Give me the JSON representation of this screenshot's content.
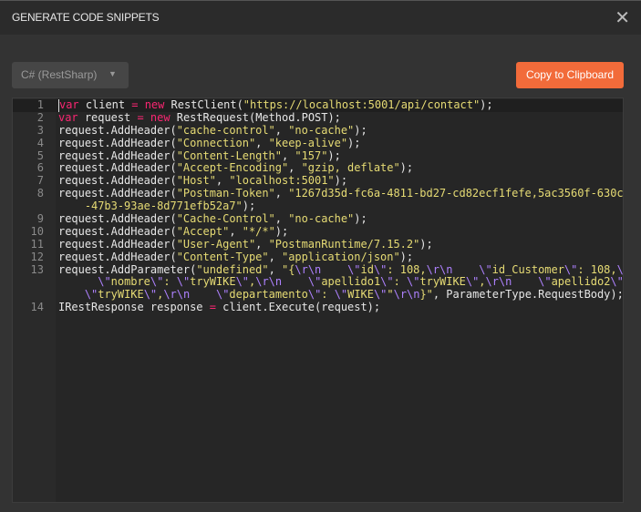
{
  "dialog": {
    "title": "GENERATE CODE SNIPPETS",
    "close_icon": "close-icon"
  },
  "toolbar": {
    "language": "C# (RestSharp)",
    "copy_label": "Copy to Clipboard",
    "accent": "#f26b3a"
  },
  "code": [
    {
      "n": "1",
      "rows": [
        [
          [
            "kw",
            "var"
          ],
          [
            "plain",
            " client "
          ],
          [
            "kw",
            "="
          ],
          [
            "plain",
            " "
          ],
          [
            "kw",
            "new"
          ],
          [
            "plain",
            " RestClient("
          ],
          [
            "str",
            "\"https://localhost:5001/api/contact\""
          ],
          [
            "plain",
            ");"
          ]
        ]
      ]
    },
    {
      "n": "2",
      "rows": [
        [
          [
            "kw",
            "var"
          ],
          [
            "plain",
            " request "
          ],
          [
            "kw",
            "="
          ],
          [
            "plain",
            " "
          ],
          [
            "kw",
            "new"
          ],
          [
            "plain",
            " RestRequest(Method.POST);"
          ]
        ]
      ]
    },
    {
      "n": "3",
      "rows": [
        [
          [
            "plain",
            "request.AddHeader("
          ],
          [
            "str",
            "\"cache-control\""
          ],
          [
            "plain",
            ", "
          ],
          [
            "str",
            "\"no-cache\""
          ],
          [
            "plain",
            ");"
          ]
        ]
      ]
    },
    {
      "n": "4",
      "rows": [
        [
          [
            "plain",
            "request.AddHeader("
          ],
          [
            "str",
            "\"Connection\""
          ],
          [
            "plain",
            ", "
          ],
          [
            "str",
            "\"keep-alive\""
          ],
          [
            "plain",
            ");"
          ]
        ]
      ]
    },
    {
      "n": "5",
      "rows": [
        [
          [
            "plain",
            "request.AddHeader("
          ],
          [
            "str",
            "\"Content-Length\""
          ],
          [
            "plain",
            ", "
          ],
          [
            "str",
            "\"157\""
          ],
          [
            "plain",
            ");"
          ]
        ]
      ]
    },
    {
      "n": "6",
      "rows": [
        [
          [
            "plain",
            "request.AddHeader("
          ],
          [
            "str",
            "\"Accept-Encoding\""
          ],
          [
            "plain",
            ", "
          ],
          [
            "str",
            "\"gzip, deflate\""
          ],
          [
            "plain",
            ");"
          ]
        ]
      ]
    },
    {
      "n": "7",
      "rows": [
        [
          [
            "plain",
            "request.AddHeader("
          ],
          [
            "str",
            "\"Host\""
          ],
          [
            "plain",
            ", "
          ],
          [
            "str",
            "\"localhost:5001\""
          ],
          [
            "plain",
            ");"
          ]
        ]
      ]
    },
    {
      "n": "8",
      "rows": [
        [
          [
            "plain",
            "request.AddHeader("
          ],
          [
            "str",
            "\"Postman-Token\""
          ],
          [
            "plain",
            ", "
          ],
          [
            "str",
            "\"1267d35d-fc6a-4811-bd27-cd82ecf1fefe,5ac3560f-630c"
          ]
        ],
        [
          [
            "str",
            "    -47b3-93ae-8d771efb52a7\""
          ],
          [
            "plain",
            ");"
          ]
        ]
      ]
    },
    {
      "n": "9",
      "rows": [
        [
          [
            "plain",
            "request.AddHeader("
          ],
          [
            "str",
            "\"Cache-Control\""
          ],
          [
            "plain",
            ", "
          ],
          [
            "str",
            "\"no-cache\""
          ],
          [
            "plain",
            ");"
          ]
        ]
      ]
    },
    {
      "n": "10",
      "rows": [
        [
          [
            "plain",
            "request.AddHeader("
          ],
          [
            "str",
            "\"Accept\""
          ],
          [
            "plain",
            ", "
          ],
          [
            "str",
            "\"*/*\""
          ],
          [
            "plain",
            ");"
          ]
        ]
      ]
    },
    {
      "n": "11",
      "rows": [
        [
          [
            "plain",
            "request.AddHeader("
          ],
          [
            "str",
            "\"User-Agent\""
          ],
          [
            "plain",
            ", "
          ],
          [
            "str",
            "\"PostmanRuntime/7.15.2\""
          ],
          [
            "plain",
            ");"
          ]
        ]
      ]
    },
    {
      "n": "12",
      "rows": [
        [
          [
            "plain",
            "request.AddHeader("
          ],
          [
            "str",
            "\"Content-Type\""
          ],
          [
            "plain",
            ", "
          ],
          [
            "str",
            "\"application/json\""
          ],
          [
            "plain",
            ");"
          ]
        ]
      ]
    },
    {
      "n": "13",
      "rows": [
        [
          [
            "plain",
            "request.AddParameter("
          ],
          [
            "str",
            "\"undefined\""
          ],
          [
            "plain",
            ", "
          ],
          [
            "str",
            "\"{"
          ],
          [
            "esc",
            "\\r\\n"
          ],
          [
            "str",
            "    "
          ],
          [
            "esc",
            "\\\""
          ],
          [
            "str",
            "id"
          ],
          [
            "esc",
            "\\\""
          ],
          [
            "str",
            ": 108,"
          ],
          [
            "esc",
            "\\r\\n"
          ],
          [
            "str",
            "    "
          ],
          [
            "esc",
            "\\\""
          ],
          [
            "str",
            "id_Customer"
          ],
          [
            "esc",
            "\\\""
          ],
          [
            "str",
            ": 108,"
          ],
          [
            "esc",
            "\\r\\n"
          ]
        ],
        [
          [
            "str",
            "      "
          ],
          [
            "esc",
            "\\\""
          ],
          [
            "str",
            "nombre"
          ],
          [
            "esc",
            "\\\""
          ],
          [
            "str",
            ": "
          ],
          [
            "esc",
            "\\\""
          ],
          [
            "str",
            "tryWIKE"
          ],
          [
            "esc",
            "\\\""
          ],
          [
            "str",
            ","
          ],
          [
            "esc",
            "\\r\\n"
          ],
          [
            "str",
            "    "
          ],
          [
            "esc",
            "\\\""
          ],
          [
            "str",
            "apellido1"
          ],
          [
            "esc",
            "\\\""
          ],
          [
            "str",
            ": "
          ],
          [
            "esc",
            "\\\""
          ],
          [
            "str",
            "tryWIKE"
          ],
          [
            "esc",
            "\\\""
          ],
          [
            "str",
            ","
          ],
          [
            "esc",
            "\\r\\n"
          ],
          [
            "str",
            "    "
          ],
          [
            "esc",
            "\\\""
          ],
          [
            "str",
            "apellido2"
          ],
          [
            "esc",
            "\\\""
          ],
          [
            "str",
            ":"
          ]
        ],
        [
          [
            "str",
            "    "
          ],
          [
            "esc",
            "\\\""
          ],
          [
            "str",
            "tryWIKE"
          ],
          [
            "esc",
            "\\\""
          ],
          [
            "str",
            ","
          ],
          [
            "esc",
            "\\r\\n"
          ],
          [
            "str",
            "    "
          ],
          [
            "esc",
            "\\\""
          ],
          [
            "str",
            "departamento"
          ],
          [
            "esc",
            "\\\""
          ],
          [
            "str",
            ": "
          ],
          [
            "esc",
            "\\\""
          ],
          [
            "str",
            "WIKE"
          ],
          [
            "esc",
            "\\\""
          ],
          [
            "str",
            "\""
          ],
          [
            "esc",
            "\\r\\n"
          ],
          [
            "str",
            "}\""
          ],
          [
            "plain",
            ", ParameterType.RequestBody);"
          ]
        ]
      ]
    },
    {
      "n": "14",
      "rows": [
        [
          [
            "plain",
            "IRestResponse response "
          ],
          [
            "kw",
            "="
          ],
          [
            "plain",
            " client.Execute(request);"
          ]
        ]
      ]
    }
  ]
}
